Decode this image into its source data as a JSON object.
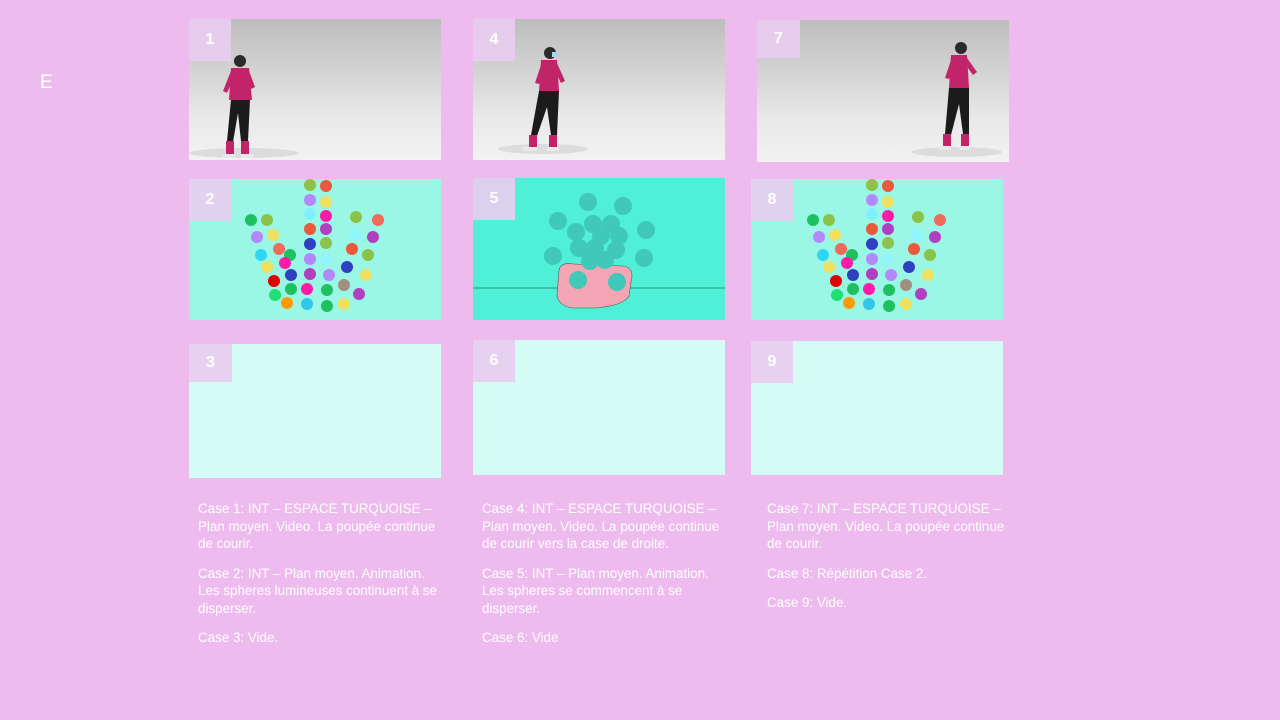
{
  "page": {
    "letter": "E",
    "background": "#eebbee"
  },
  "panels": [
    {
      "number": "1",
      "kind": "video",
      "image": "woman-running-left-photo"
    },
    {
      "number": "2",
      "kind": "animation",
      "image": "spheres-dispersing"
    },
    {
      "number": "3",
      "kind": "empty"
    },
    {
      "number": "4",
      "kind": "video",
      "image": "woman-running-right-photo"
    },
    {
      "number": "5",
      "kind": "animation",
      "image": "spheres-clustered-on-pink-base"
    },
    {
      "number": "6",
      "kind": "empty"
    },
    {
      "number": "7",
      "kind": "video",
      "image": "woman-running-right-photo"
    },
    {
      "number": "8",
      "kind": "animation",
      "image": "spheres-dispersing"
    },
    {
      "number": "9",
      "kind": "empty"
    }
  ],
  "descriptions": {
    "col1": [
      "Case 1: INT – ESPACE TURQUOISE – Plan moyen. Video. La poupée continue de courir.",
      "Case 2: INT – Plan moyen. Animation. Les spheres lumineuses continuent à se disperser.",
      "Case 3: Vide."
    ],
    "col2": [
      "Case 4: INT – ESPACE TURQUOISE – Plan moyen. Video. La poupée continue de courir vers la case de droite.",
      "Case 5: INT – Plan moyen. Animation. Les spheres se commencent à se disperser.",
      "Case 6: Vide"
    ],
    "col3": [
      "Case 7: INT – ESPACE TURQUOISE – Plan moyen. Video. La poupée continue de courir.",
      "Case 8: Répétition Case 2.",
      "Case 9: Vide."
    ]
  },
  "colors": {
    "turquoise_light": "#9af7e6",
    "turquoise_bright": "#4ff0d7",
    "empty_panel": "#d4fbf4",
    "shirt": "#c2246a",
    "pink_base": "#f4a6b4"
  }
}
